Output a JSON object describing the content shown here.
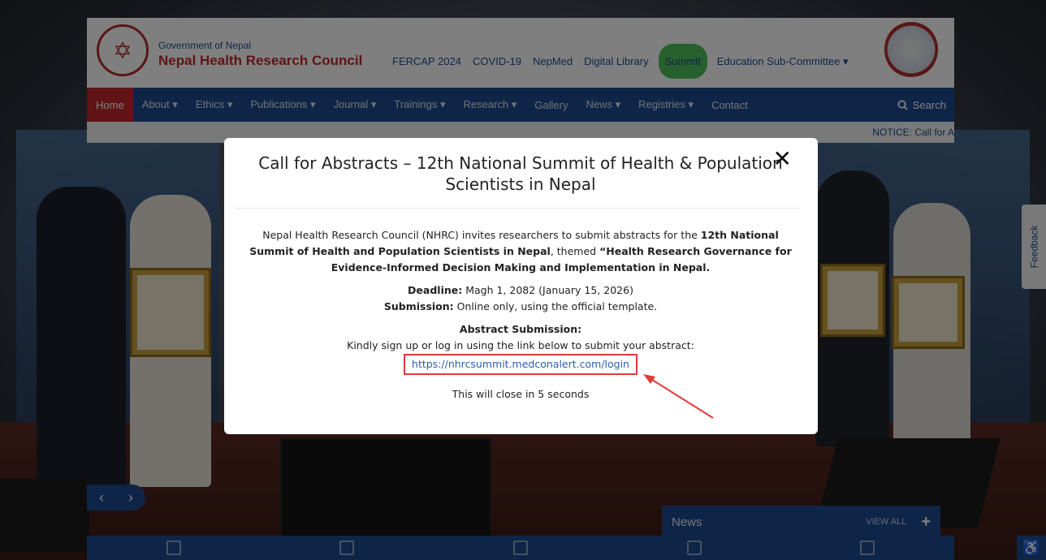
{
  "header": {
    "org_sub": "Government of Nepal",
    "org_title": "Nepal Health Research Council",
    "top_links": [
      {
        "label": "FERCAP 2024"
      },
      {
        "label": "COVID-19"
      },
      {
        "label": "NepMed"
      },
      {
        "label": "Digital Library"
      },
      {
        "label": "Summit"
      },
      {
        "label": "Education Sub-Committee ▾"
      }
    ]
  },
  "nav": {
    "items": [
      {
        "label": "Home"
      },
      {
        "label": "About ▾"
      },
      {
        "label": "Ethics ▾"
      },
      {
        "label": "Publications ▾"
      },
      {
        "label": "Journal ▾"
      },
      {
        "label": "Trainings ▾"
      },
      {
        "label": "Research ▾"
      },
      {
        "label": "Gallery"
      },
      {
        "label": "News ▾"
      },
      {
        "label": "Registries ▾"
      },
      {
        "label": "Contact"
      }
    ],
    "search_label": "Search"
  },
  "notice": {
    "text": "NOTICE: Call for A"
  },
  "feedback": {
    "label": "Feedback"
  },
  "news": {
    "title": "News",
    "view_all": "VIEW ALL",
    "plus": "+"
  },
  "slider": {
    "prev": "‹",
    "next": "›"
  },
  "modal": {
    "title": "Call for Abstracts – 12th National Summit of Health & Population Scientists in Nepal",
    "close": "✕",
    "intro_pre": "Nepal Health Research Council (NHRC) invites researchers to submit abstracts for the ",
    "intro_bold1": "12th National Summit of Health and Population Scientists in Nepal",
    "intro_mid": ", themed ",
    "intro_bold2": "“Health Research Governance for Evidence-Informed Decision Making and Implementation in Nepal.",
    "deadline_label": "Deadline:",
    "deadline_value": " Magh 1, 2082 (January 15, 2026)",
    "submission_label": "Submission:",
    "submission_value": " Online only, using the official template.",
    "abstract_heading": "Abstract Submission:",
    "instruction": "Kindly sign up or log in using the link below to submit your abstract:",
    "link": "https://nhrcsummit.medconalert.com/login",
    "closing": "This will close in 5 seconds"
  },
  "colors": {
    "brand_blue": "#1f4a90",
    "brand_red": "#c0292a",
    "summit_green": "#4fc05a",
    "annotation_red": "#e23b3b",
    "link_blue": "#2b5eb3"
  }
}
